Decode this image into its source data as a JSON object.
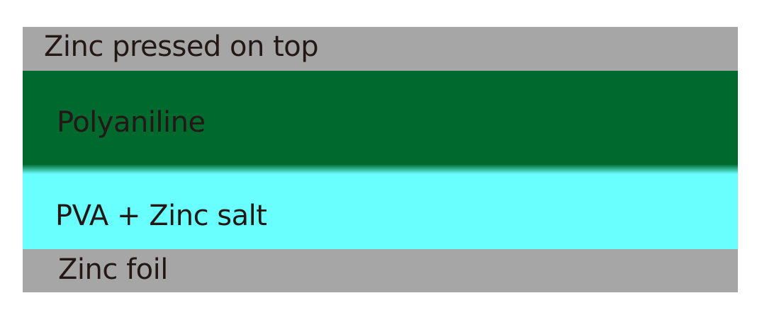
{
  "layers": [
    {
      "label": "Zinc pressed on top",
      "color": "#a6a6a6"
    },
    {
      "label": "Polyaniline",
      "color": "#006a2e"
    },
    {
      "label": "PVA + Zinc salt",
      "color": "#6affff"
    },
    {
      "label": "Zinc foil",
      "color": "#a6a6a6"
    }
  ]
}
